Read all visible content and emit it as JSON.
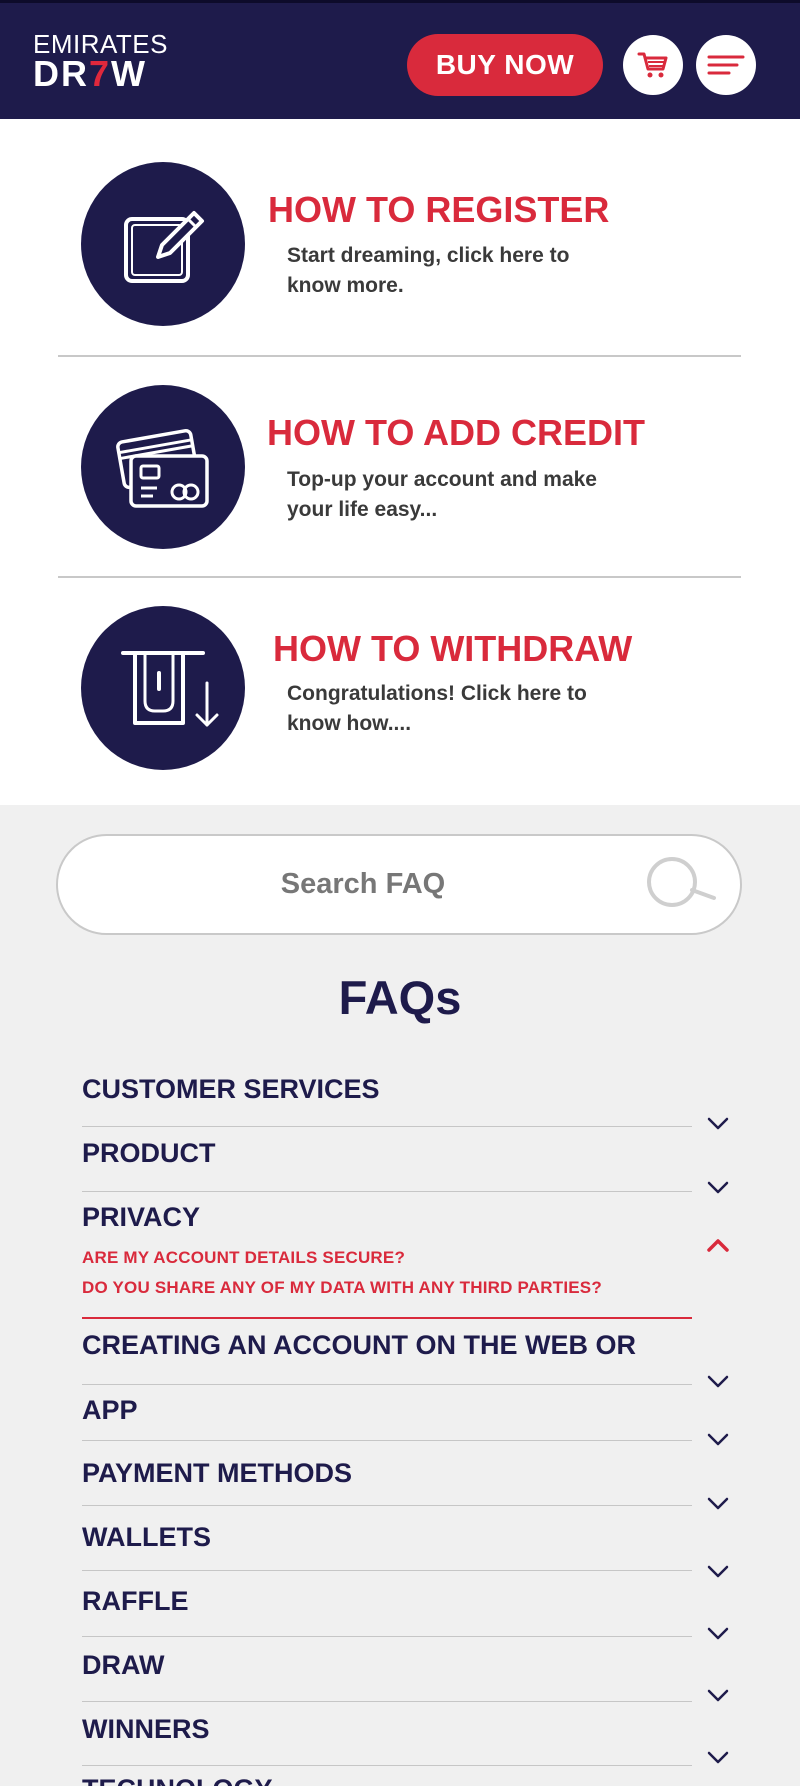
{
  "header": {
    "logo_line1": "EMIRATES",
    "logo_line2_a": "DR",
    "logo_line2_b": "7",
    "logo_line2_c": "W",
    "buy_now": "BUY NOW",
    "cart_icon": "cart-icon",
    "menu_icon": "menu-icon"
  },
  "howto": [
    {
      "title": "HOW TO REGISTER",
      "desc": "Start dreaming, click here to know more.",
      "icon": "edit-icon"
    },
    {
      "title": "HOW TO ADD CREDIT",
      "desc": "Top-up your account and make your life easy...",
      "icon": "credit-cards-icon"
    },
    {
      "title": "HOW TO WITHDRAW",
      "desc": "Congratulations! Click here to know how....",
      "icon": "atm-withdraw-icon"
    }
  ],
  "search": {
    "placeholder": "Search FAQ",
    "icon": "search-icon"
  },
  "faq": {
    "title": "FAQs",
    "categories": [
      "CUSTOMER SERVICES",
      "PRODUCT",
      "PRIVACY",
      "CREATING AN ACCOUNT ON THE WEB OR",
      "APP",
      "PAYMENT METHODS",
      "WALLETS",
      "RAFFLE",
      "DRAW",
      "WINNERS",
      "TECHNOLOGY"
    ],
    "privacy_questions": [
      "ARE MY ACCOUNT DETAILS SECURE?",
      "DO YOU SHARE ANY OF MY DATA WITH ANY THIRD PARTIES?"
    ]
  },
  "colors": {
    "navy": "#1e1b4b",
    "red": "#d92a3c"
  }
}
